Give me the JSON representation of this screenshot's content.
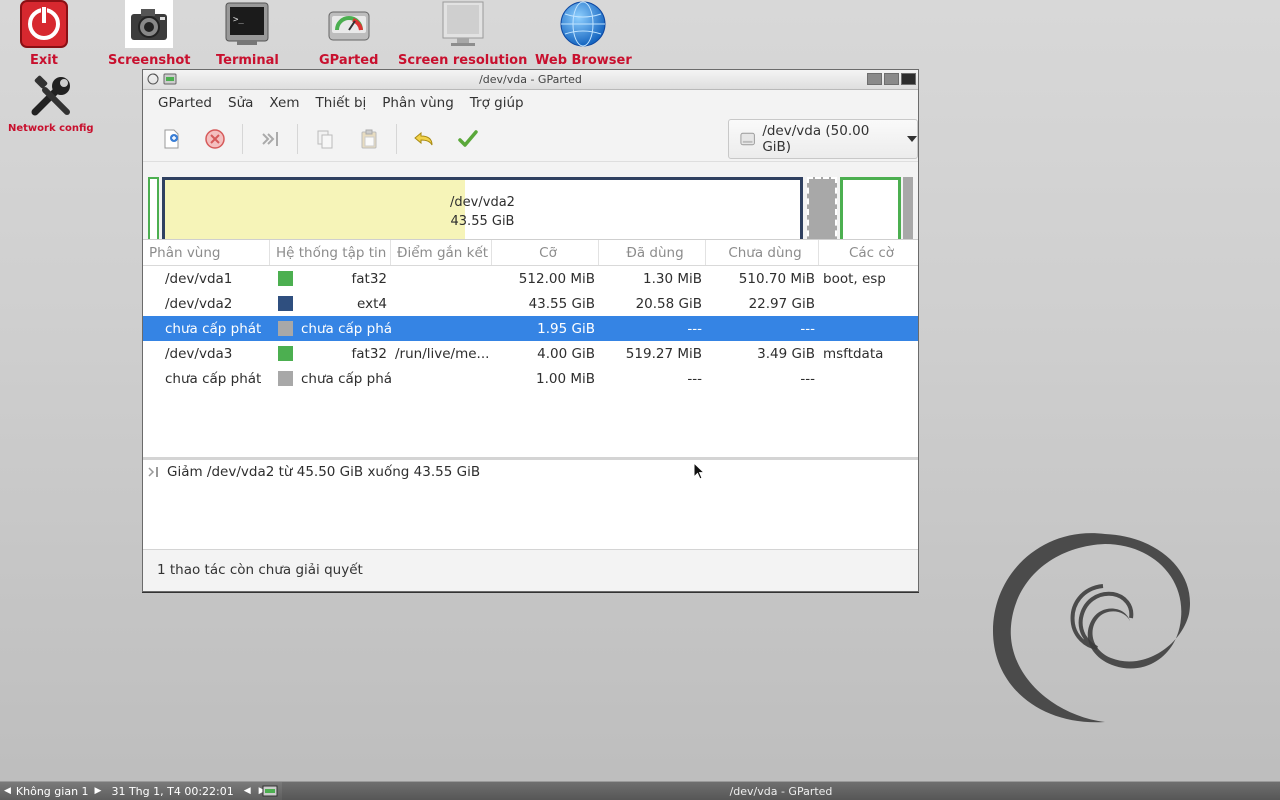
{
  "desktop": {
    "icons": [
      {
        "label": "Exit",
        "icon": "power-icon"
      },
      {
        "label": "Screenshot",
        "icon": "camera-icon"
      },
      {
        "label": "Terminal",
        "icon": "terminal-icon"
      },
      {
        "label": "GParted",
        "icon": "disk-icon"
      },
      {
        "label": "Screen resolution",
        "icon": "monitor-icon"
      },
      {
        "label": "Web Browser",
        "icon": "globe-icon"
      },
      {
        "label": "Network config",
        "icon": "tools-icon"
      }
    ]
  },
  "window": {
    "title": "/dev/vda - GParted",
    "menu": [
      "GParted",
      "Sửa",
      "Xem",
      "Thiết bị",
      "Phân vùng",
      "Trợ giúp"
    ],
    "device": "/dev/vda (50.00 GiB)",
    "diskmap": {
      "label_name": "/dev/vda2",
      "label_size": "43.55 GiB"
    },
    "columns": [
      "Phân vùng",
      "Hệ thống tập tin",
      "Điểm gắn kết",
      "Cỡ",
      "Đã dùng",
      "Chưa dùng",
      "Các cờ"
    ],
    "rows": [
      {
        "partition": "/dev/vda1",
        "fs": "fat32",
        "mount": "",
        "size": "512.00 MiB",
        "used": "1.30 MiB",
        "unused": "510.70 MiB",
        "flags": "boot, esp",
        "color": "#4caf50",
        "locked": false,
        "selected": false,
        "fs_left": false
      },
      {
        "partition": "/dev/vda2",
        "fs": "ext4",
        "mount": "",
        "size": "43.55 GiB",
        "used": "20.58 GiB",
        "unused": "22.97 GiB",
        "flags": "",
        "color": "#2f4f7f",
        "locked": false,
        "selected": false,
        "fs_left": false
      },
      {
        "partition": "chưa cấp phát",
        "fs": "chưa cấp phát",
        "mount": "",
        "size": "1.95 GiB",
        "used": "---",
        "unused": "---",
        "flags": "",
        "color": "#a8a8a8",
        "locked": false,
        "selected": true,
        "fs_left": true
      },
      {
        "partition": "/dev/vda3",
        "fs": "fat32",
        "mount": "/run/live/me...",
        "size": "4.00 GiB",
        "used": "519.27 MiB",
        "unused": "3.49 GiB",
        "flags": "msftdata",
        "color": "#4caf50",
        "locked": true,
        "selected": false,
        "fs_left": false
      },
      {
        "partition": "chưa cấp phát",
        "fs": "chưa cấp phát",
        "mount": "",
        "size": "1.00 MiB",
        "used": "---",
        "unused": "---",
        "flags": "",
        "color": "#a8a8a8",
        "locked": false,
        "selected": false,
        "fs_left": true
      }
    ],
    "operation": "Giảm /dev/vda2 từ 45.50 GiB xuống 43.55 GiB",
    "status": "1 thao tác còn chưa giải quyết"
  },
  "taskbar": {
    "workspace": "Không gian 1",
    "clock": "31 Thg 1, T4 00:22:01",
    "task": "/dev/vda - GParted"
  },
  "colors": {
    "selection": "#3584e4",
    "desktop_label": "#c8102e",
    "fat32": "#4caf50",
    "ext4": "#2f4f7f",
    "unallocated": "#a8a8a8"
  }
}
